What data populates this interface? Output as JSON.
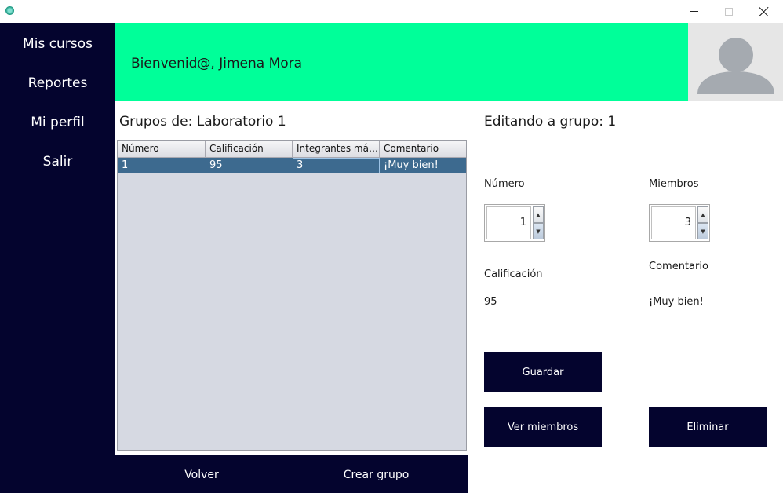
{
  "window": {
    "icons": {
      "app": "app-icon",
      "minimize": "minimize-icon",
      "maximize": "maximize-icon",
      "close": "close-icon"
    }
  },
  "sidebar": {
    "items": [
      {
        "label": "Mis cursos"
      },
      {
        "label": "Reportes"
      },
      {
        "label": "Mi perfil"
      },
      {
        "label": "Salir"
      }
    ]
  },
  "header": {
    "welcome": "Bienvenid@, Jimena Mora",
    "bg_color": "#00ff99",
    "avatar_icon": "user-avatar-icon"
  },
  "groups": {
    "title": "Grupos de: Laboratorio 1",
    "columns": [
      "Número",
      "Calificación",
      "Integrantes máxi...",
      "Comentario"
    ],
    "rows": [
      [
        "1",
        "95",
        "3",
        "¡Muy bien!"
      ]
    ]
  },
  "bottom": {
    "back_label": "Volver",
    "create_label": "Crear grupo"
  },
  "editor": {
    "title": "Editando a grupo: 1",
    "numero_label": "Número",
    "numero_value": "1",
    "miembros_label": "Miembros",
    "miembros_value": "3",
    "calificacion_label": "Calificación",
    "calificacion_value": "95",
    "comentario_label": "Comentario",
    "comentario_value": "¡Muy bien!",
    "save_label": "Guardar",
    "members_label": "Ver miembros",
    "delete_label": "Eliminar"
  },
  "colors": {
    "sidebar": "#04042e",
    "selection": "#3d6a8f",
    "table_bg": "#d6d9e2"
  }
}
